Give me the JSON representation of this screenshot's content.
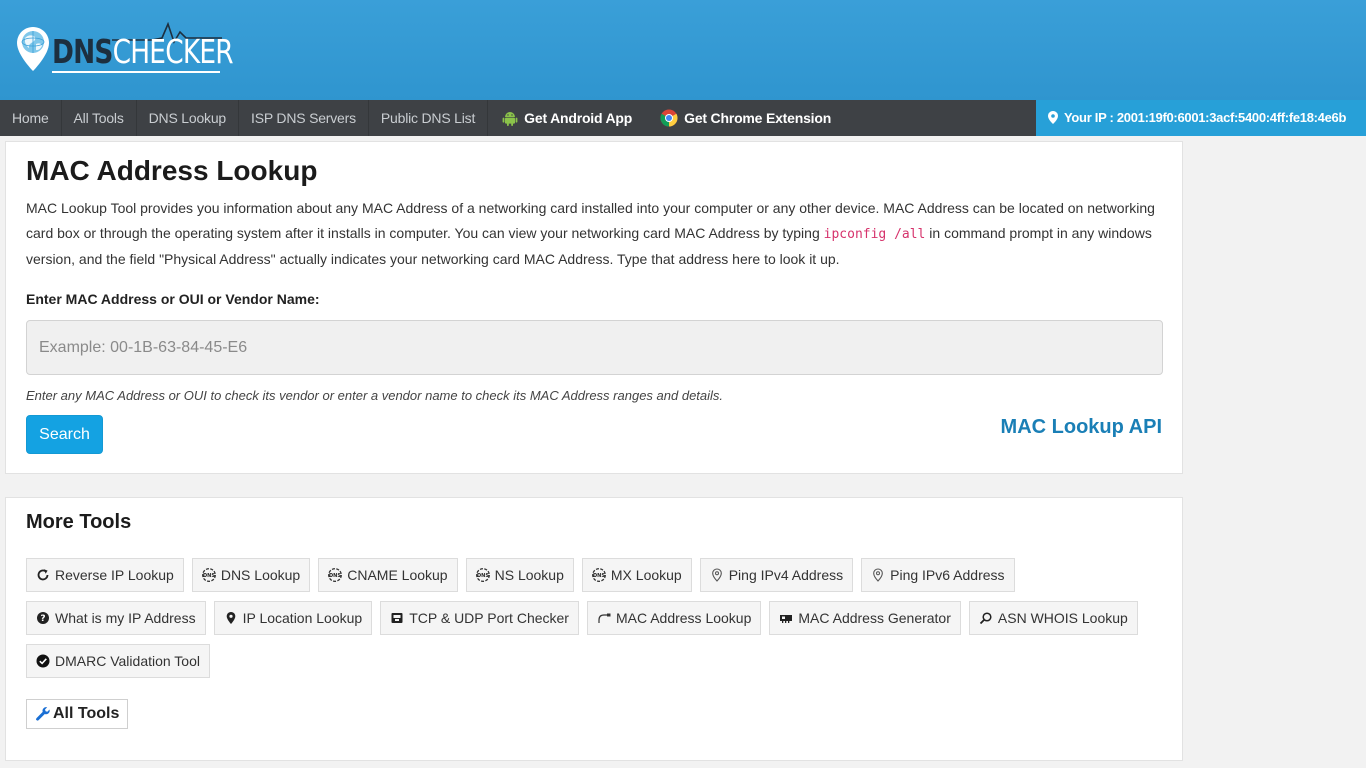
{
  "brand": {
    "dns": "DNS",
    "checker": "CHECKER"
  },
  "nav": {
    "items": [
      "Home",
      "All Tools",
      "DNS Lookup",
      "ISP DNS Servers",
      "Public DNS List"
    ],
    "android": "Get Android App",
    "chrome": "Get Chrome Extension",
    "ip_label": "Your IP : 2001:19f0:6001:3acf:5400:4ff:fe18:4e6b"
  },
  "lookup": {
    "title": "MAC Address Lookup",
    "desc_part1": "MAC Lookup Tool provides you information about any MAC Address of a networking card installed into your computer or any other device. MAC Address can be located on networking card box or through the operating system after it installs in computer. You can view your networking card MAC Address by typing ",
    "desc_code": "ipconfig /all",
    "desc_part2": " in command prompt in any windows version, and the field \"Physical Address\" actually indicates your networking card MAC Address. Type that address here to look it up.",
    "field_label": "Enter MAC Address or OUI or Vendor Name:",
    "placeholder": "Example: 00-1B-63-84-45-E6",
    "value": "",
    "hint": "Enter any MAC Address or OUI to check its vendor or enter a vendor name to check its MAC Address ranges and details.",
    "search_label": "Search",
    "api_label": "MAC Lookup API"
  },
  "more_tools": {
    "title": "More Tools",
    "rows": [
      [
        {
          "label": "Reverse IP Lookup",
          "icon": "refresh-icon"
        },
        {
          "label": "DNS Lookup",
          "icon": "dns-icon"
        },
        {
          "label": "CNAME Lookup",
          "icon": "dns-icon"
        },
        {
          "label": "NS Lookup",
          "icon": "dns-icon"
        },
        {
          "label": "MX Lookup",
          "icon": "dns-icon"
        },
        {
          "label": "Ping IPv4 Address",
          "icon": "map-pin-outline-icon"
        },
        {
          "label": "Ping IPv6 Address",
          "icon": "map-pin-outline-icon"
        }
      ],
      [
        {
          "label": "What is my IP Address",
          "icon": "question-circle-icon"
        },
        {
          "label": "IP Location Lookup",
          "icon": "map-marker-icon"
        },
        {
          "label": "TCP & UDP Port Checker",
          "icon": "port-icon"
        },
        {
          "label": "MAC Address Lookup",
          "icon": "network-cable-icon"
        },
        {
          "label": "MAC Address Generator",
          "icon": "network-card-icon"
        },
        {
          "label": "ASN WHOIS Lookup",
          "icon": "magnifier-icon"
        }
      ],
      [
        {
          "label": "DMARC Validation Tool",
          "icon": "check-circle-icon"
        }
      ]
    ],
    "all_tools": "All Tools"
  },
  "colors": {
    "header": "#3a9fd8",
    "nav": "#3e4145",
    "ip_bg": "#27a0d8",
    "button": "#14a2e2",
    "api_link": "#1a7fb6",
    "code": "#d6336c"
  }
}
